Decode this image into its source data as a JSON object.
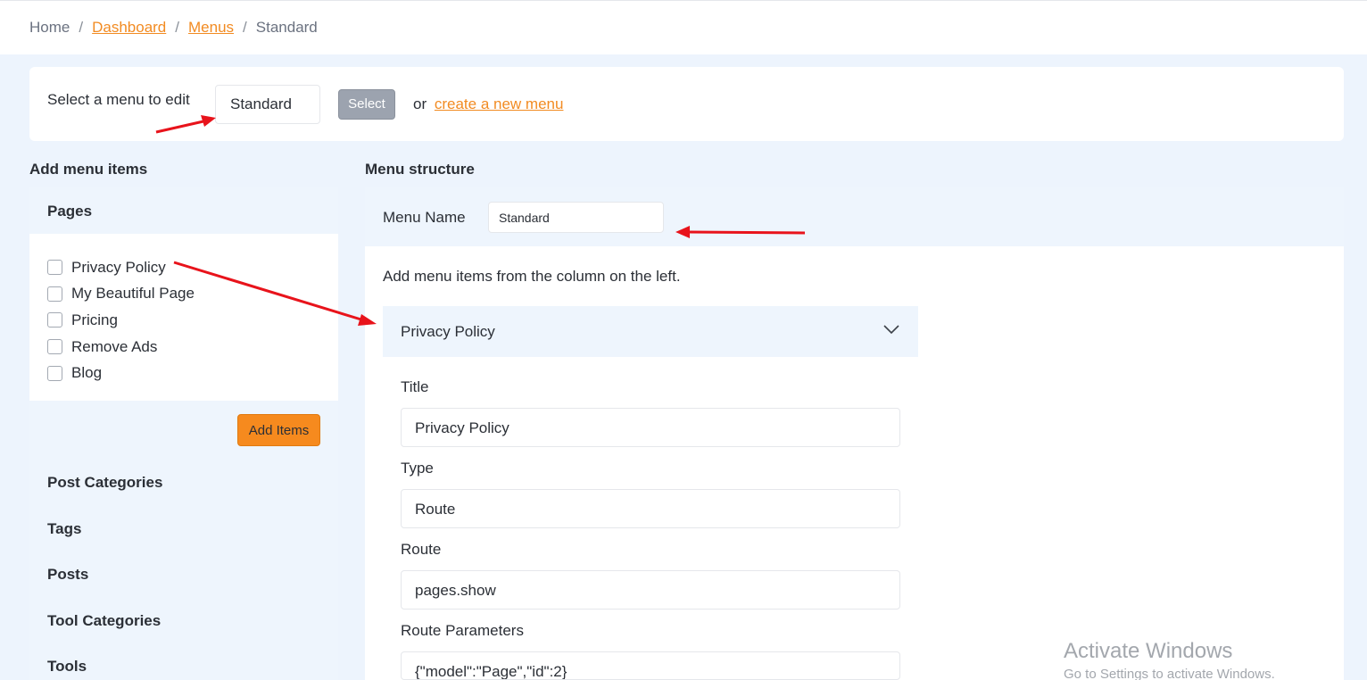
{
  "breadcrumb": {
    "home": "Home",
    "sep": "/",
    "dashboard": "Dashboard",
    "menus": "Menus",
    "current": "Standard"
  },
  "select_menu": {
    "label": "Select a menu to edit",
    "value": "Standard",
    "button": "Select",
    "or": "or",
    "create_link": "create a new menu"
  },
  "add_items": {
    "heading": "Add menu items",
    "pages_heading": "Pages",
    "pages": [
      "Privacy Policy",
      "My Beautiful Page",
      "Pricing",
      "Remove Ads",
      "Blog"
    ],
    "add_button": "Add Items",
    "sections": [
      "Post Categories",
      "Tags",
      "Posts",
      "Tool Categories",
      "Tools"
    ]
  },
  "structure": {
    "heading": "Menu structure",
    "menu_name_label": "Menu Name",
    "menu_name_value": "Standard",
    "hint": "Add menu items from the column on the left.",
    "item": {
      "title": "Privacy Policy",
      "fields": [
        {
          "label": "Title",
          "value": "Privacy Policy"
        },
        {
          "label": "Type",
          "value": "Route"
        },
        {
          "label": "Route",
          "value": "pages.show"
        },
        {
          "label": "Route Parameters",
          "value": "{\"model\":\"Page\",\"id\":2}"
        }
      ]
    }
  },
  "watermark": {
    "title": "Activate Windows",
    "subtitle": "Go to Settings to activate Windows."
  },
  "colors": {
    "accent": "#f28b22",
    "button_orange": "#f68a1e",
    "annotation_arrow": "#e8131b",
    "panel_bg": "#eef5fd"
  }
}
